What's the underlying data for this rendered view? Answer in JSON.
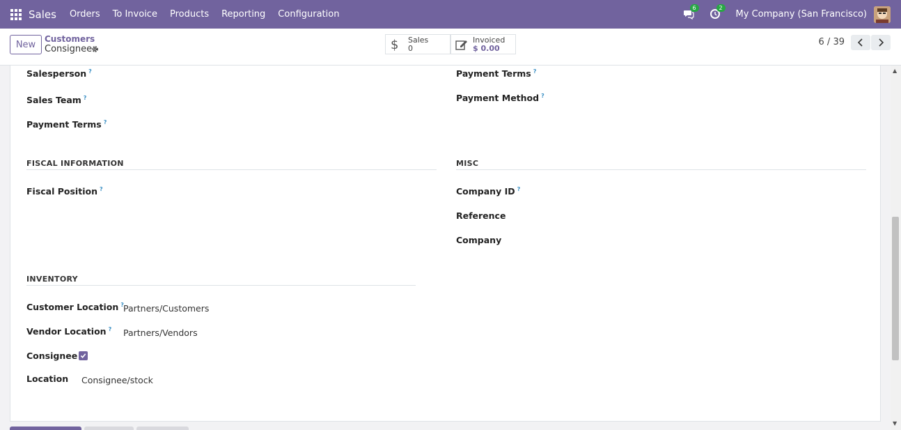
{
  "topbar": {
    "app_name": "Sales",
    "menu": [
      "Orders",
      "To Invoice",
      "Products",
      "Reporting",
      "Configuration"
    ],
    "messages_count": "6",
    "activities_count": "2",
    "company": "My Company (San Francisco)",
    "accent": "#71639e"
  },
  "control": {
    "new_label": "New",
    "breadcrumb_parent": "Customers",
    "record_name": "Consignee",
    "stats": [
      {
        "label": "Sales",
        "value": "0",
        "icon": "dollar-icon"
      },
      {
        "label": "Invoiced",
        "value": "$ 0.00",
        "icon": "pencil-square-icon"
      }
    ],
    "pager": "6 / 39"
  },
  "form": {
    "left_top": {
      "salesperson": "Salesperson",
      "sales_team": "Sales Team",
      "payment_terms": "Payment Terms"
    },
    "right_top": {
      "payment_terms": "Payment Terms",
      "payment_method": "Payment Method"
    },
    "fiscal": {
      "title": "FISCAL INFORMATION",
      "fiscal_position": "Fiscal Position"
    },
    "misc": {
      "title": "MISC",
      "company_id": "Company ID",
      "reference": "Reference",
      "company": "Company"
    },
    "inventory": {
      "title": "INVENTORY",
      "customer_location_label": "Customer Location",
      "customer_location_value": "Partners/Customers",
      "vendor_location_label": "Vendor Location",
      "vendor_location_value": "Partners/Vendors",
      "consignee_label": "Consignee",
      "consignee_checked": true,
      "location_label": "Location",
      "location_value": "Consignee/stock"
    },
    "help_mark": "?"
  }
}
